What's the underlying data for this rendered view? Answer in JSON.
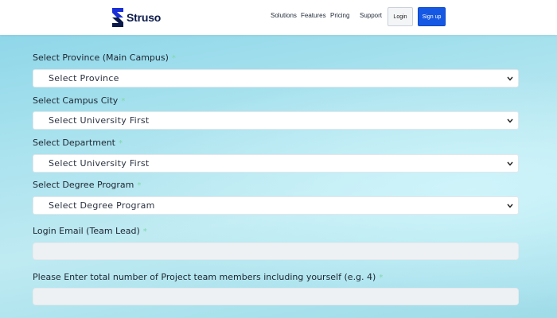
{
  "header": {
    "brand": "Struso",
    "nav": [
      "Solutions",
      "Features",
      "Pricing",
      "Support"
    ],
    "login_label": "Login",
    "signup_label": "Sign up",
    "signup_color": "#1558e3"
  },
  "form": {
    "province": {
      "label": "Select Province (Main Campus)",
      "required_mark": "*",
      "selected": "Select Province"
    },
    "campus_city": {
      "label": "Select Campus City",
      "required_mark": "*",
      "selected": "Select University First"
    },
    "department": {
      "label": "Select Department",
      "required_mark": "*",
      "selected": "Select University First"
    },
    "degree_program": {
      "label": "Select Degree Program",
      "required_mark": "*",
      "selected": "Select Degree Program"
    },
    "login_email": {
      "label": "Login Email (Team Lead)",
      "required_mark": "*",
      "value": ""
    },
    "team_members": {
      "label": "Please Enter total number of Project team members including yourself (e.g. 4)",
      "required_mark": "*",
      "value": ""
    }
  },
  "icons": {
    "logo": "struso-logo-icon",
    "chevron": "chevron-down-icon"
  }
}
